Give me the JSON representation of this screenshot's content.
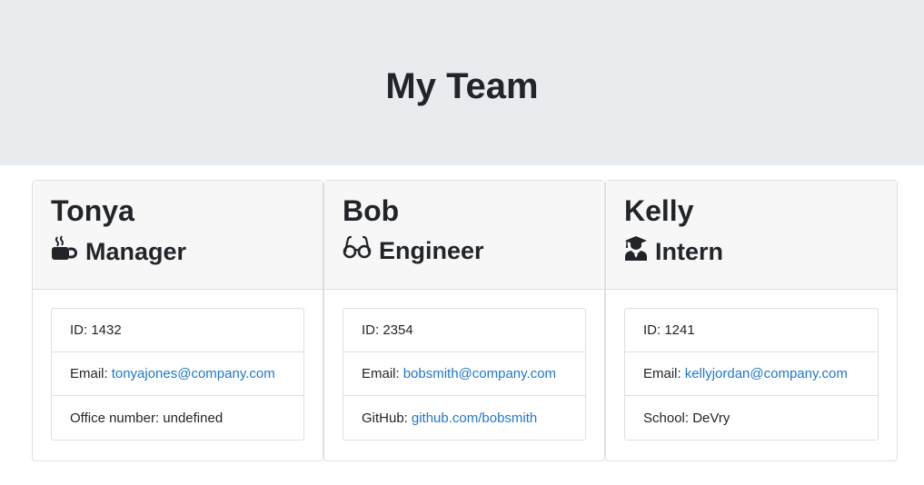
{
  "header": {
    "title": "My Team"
  },
  "cards": [
    {
      "name": "Tonya",
      "role": "Manager",
      "icon": "mug-icon",
      "id_text": "ID: 1432",
      "email_label": "Email:",
      "email": "tonyajones@company.com",
      "extra_text": "Office number: undefined"
    },
    {
      "name": "Bob",
      "role": "Engineer",
      "icon": "glasses-icon",
      "id_text": "ID: 2354",
      "email_label": "Email:",
      "email": "bobsmith@company.com",
      "extra_label": "GitHub:",
      "extra_link": "github.com/bobsmith"
    },
    {
      "name": "Kelly",
      "role": "Intern",
      "icon": "graduate-icon",
      "id_text": "ID: 1241",
      "email_label": "Email:",
      "email": "kellyjordan@company.com",
      "extra_text": "School: DeVry"
    }
  ],
  "colors": {
    "header_bg": "#e9ecef",
    "link": "#1f78c8",
    "card_header_bg": "#f7f7f7"
  }
}
